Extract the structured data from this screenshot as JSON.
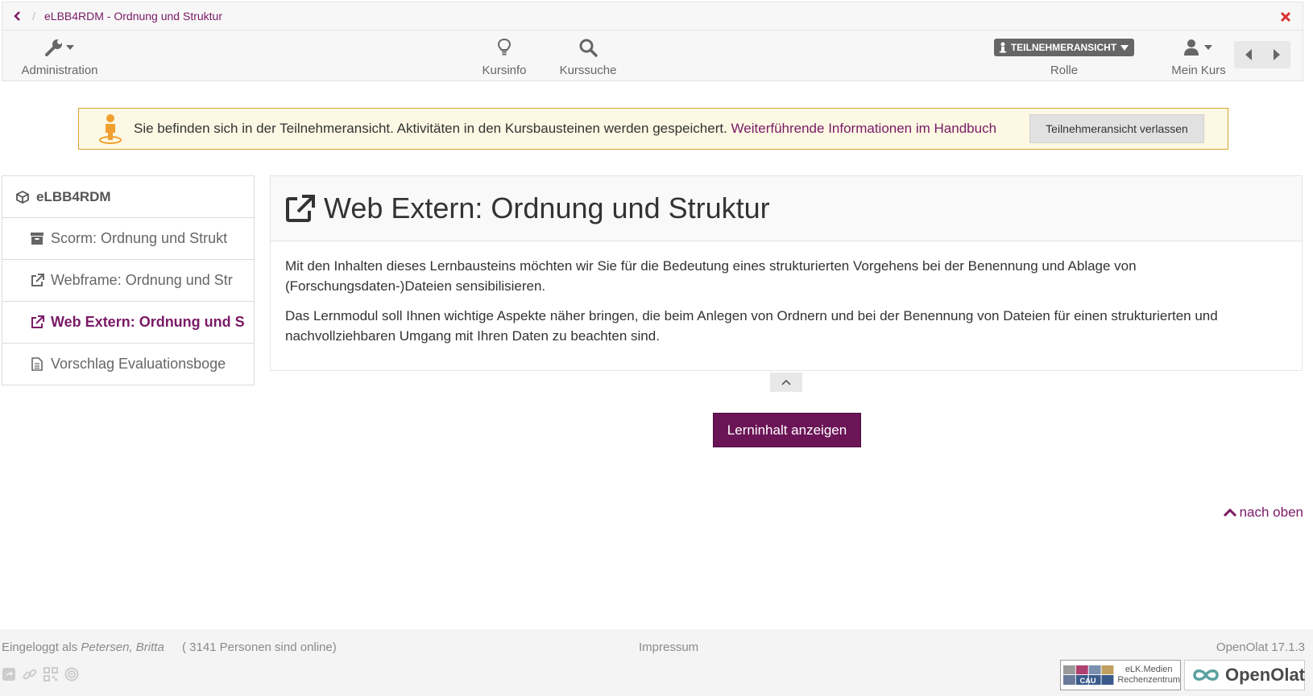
{
  "breadcrumb": {
    "title": "eLBB4RDM - Ordnung und Struktur",
    "separator": "/"
  },
  "toolbar": {
    "admin_label": "Administration",
    "kursinfo_label": "Kursinfo",
    "kurssuche_label": "Kurssuche",
    "role_badge": "TEILNEHMERANSICHT",
    "role_label": "Rolle",
    "meinkurs_label": "Mein Kurs"
  },
  "notice": {
    "text": "Sie befinden sich in der Teilnehmeransicht. Aktivitäten in den Kursbausteinen werden gespeichert.",
    "link": "Weiterführende Informationen im Handbuch",
    "button": "Teilnehmeransicht verlassen"
  },
  "menu": {
    "root": "eLBB4RDM",
    "items": [
      {
        "label": "Scorm: Ordnung und Strukt",
        "icon": "archive-icon",
        "active": false
      },
      {
        "label": "Webframe: Ordnung und Str",
        "icon": "external-link-icon",
        "active": false
      },
      {
        "label": "Web Extern: Ordnung und S",
        "icon": "external-link-icon",
        "active": true
      },
      {
        "label": "Vorschlag Evaluationsboge",
        "icon": "document-icon",
        "active": false
      }
    ]
  },
  "main": {
    "title": "Web Extern: Ordnung und Struktur",
    "paragraph1": "Mit den Inhalten dieses Lernbausteins möchten wir Sie für die Bedeutung eines strukturierten Vorgehens bei der Benennung und Ablage von (Forschungsdaten-)Dateien sensibilisieren.",
    "paragraph2": "Das Lernmodul soll Ihnen wichtige Aspekte näher bringen, die beim Anlegen von Ordnern und bei der Benennung von Dateien für einen strukturierten und nachvollziehbaren Umgang mit Ihren Daten zu beachten sind.",
    "launch_button": "Lerninhalt anzeigen",
    "to_top": "nach oben"
  },
  "footer": {
    "login_prefix": "Eingeloggt als",
    "user": "Petersen, Britta",
    "online": "( 3141 Personen sind online)",
    "impressum": "Impressum",
    "version": "OpenOlat 17.1.3",
    "logo_elk_line1": "eLK.Medien",
    "logo_elk_line2": "Rechenzentrum",
    "logo_cau": "CAU",
    "logo_openolat": "OpenOlat"
  },
  "colors": {
    "brand": "#7a1a66",
    "button_primary": "#6b1557",
    "notice_bg": "#fcf8e3",
    "notice_border": "#d7a32e",
    "close_red": "#d9302f"
  }
}
